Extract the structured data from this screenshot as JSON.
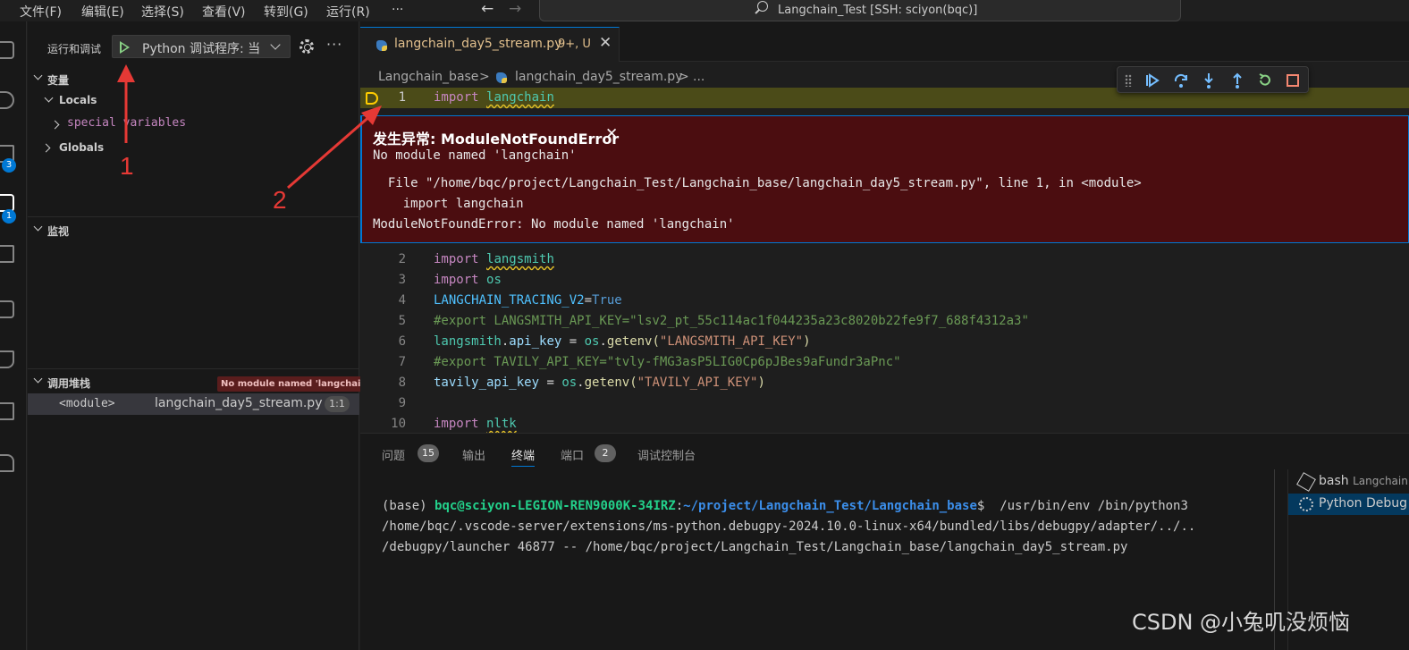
{
  "titlebar": {
    "menu": [
      "文件(F)",
      "编辑(E)",
      "选择(S)",
      "查看(V)",
      "转到(G)",
      "运行(R)",
      "···"
    ],
    "nav_back": "←",
    "nav_forward": "→",
    "command_center": "Langchain_Test [SSH: sciyon(bqc)]"
  },
  "activitybar": {
    "source_control_badge": "3",
    "run_debug_badge": "1"
  },
  "sidebar": {
    "header": "运行和调试",
    "config_name": "Python 调试程序: 当",
    "more": "···",
    "variables_section": "变量",
    "locals_label": "Locals",
    "special_variables_label": "special variables",
    "globals_label": "Globals",
    "watch_section": "监视",
    "callstack_section": "调用堆栈",
    "callstack_badge": "No module named 'langchain'",
    "frame": {
      "function": "<module>",
      "file": "langchain_day5_stream.py",
      "position": "1:1"
    }
  },
  "editor": {
    "tab": {
      "name": "langchain_day5_stream.py",
      "modified": "9+, U",
      "close": "✕"
    },
    "breadcrumb": [
      "Langchain_base",
      ">",
      "langchain_day5_stream.py",
      ">",
      "..."
    ],
    "lines": [
      {
        "n": "1",
        "kw": "import",
        "rest": "langchain"
      },
      {
        "n": "2",
        "kw": "import",
        "rest": "langsmith"
      },
      {
        "n": "3",
        "kw": "import",
        "rest": "os"
      },
      {
        "n": "4",
        "var": "LANGCHAIN_TRACING_V2",
        "op": "=",
        "val": "True"
      },
      {
        "n": "5",
        "comment": "#export LANGSMITH_API_KEY=\"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\""
      },
      {
        "n": "6",
        "obj": "langsmith",
        "dot1": ".",
        "attr": "api_key",
        "eq": " = ",
        "obj2": "os",
        "dot2": ".",
        "fn": "getenv",
        "open": "(",
        "str": "\"LANGSMITH_API_KEY\"",
        "close": ")"
      },
      {
        "n": "7",
        "comment": "#export TAVILY_API_KEY=\"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\""
      },
      {
        "n": "8",
        "var": "tavily_api_key",
        "eq": " = ",
        "obj2": "os",
        "dot2": ".",
        "fn": "getenv",
        "open": "(",
        "str": "\"TAVILY_API_KEY\"",
        "close": ")"
      },
      {
        "n": "9"
      },
      {
        "n": "10",
        "kw": "import",
        "rest": "nltk"
      }
    ]
  },
  "exception": {
    "title": "发生异常: ModuleNotFoundError",
    "close": "✕",
    "message": "No module named 'langchain'",
    "trace1": "  File \"/home/bqc/project/Langchain_Test/Langchain_base/langchain_day5_stream.py\", line 1, in <module>",
    "trace2": "    import langchain",
    "trace3": "ModuleNotFoundError: No module named 'langchain'"
  },
  "panel": {
    "tabs": [
      {
        "label": "问题",
        "count": "15"
      },
      {
        "label": "输出"
      },
      {
        "label": "终端",
        "active": true
      },
      {
        "label": "端口",
        "count": "2"
      },
      {
        "label": "调试控制台"
      }
    ],
    "terminal": {
      "env": "(base) ",
      "user": "bqc@sciyon-LEGION-REN9000K-34IRZ",
      "colon": ":",
      "path": "~/project/Langchain_Test/Langchain_base",
      "dollar": "$  /usr/bin/env /bin/python3",
      "line2": "/home/bqc/.vscode-server/extensions/ms-python.debugpy-2024.10.0-linux-x64/bundled/libs/debugpy/adapter/../..",
      "line3": "/debugpy/launcher 46877 -- /home/bqc/project/Langchain_Test/Langchain_base/langchain_day5_stream.py"
    },
    "terminal_list": [
      {
        "name": "bash",
        "sub": "Langchain"
      },
      {
        "name": "Python Debug"
      }
    ]
  },
  "annotations": {
    "one": "1",
    "two": "2"
  },
  "watermark": "CSDN @小兔叽没烦恼",
  "colors": {
    "accent": "#0078d4",
    "exception_bg": "#4b0d10",
    "annotation": "#e53935",
    "current_line": "#4b4b18"
  }
}
